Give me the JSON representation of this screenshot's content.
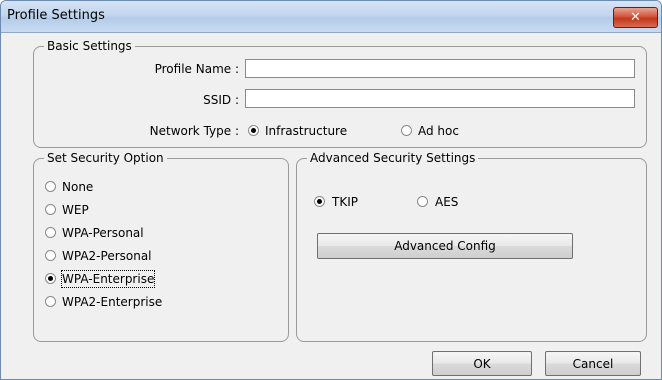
{
  "window": {
    "title": "Profile Settings",
    "close_glyph": "✕"
  },
  "basic": {
    "legend": "Basic Settings",
    "profile_name_label": "Profile Name :",
    "profile_name_value": "",
    "ssid_label": "SSID :",
    "ssid_value": "",
    "network_type_label": "Network Type :",
    "options": [
      "Infrastructure",
      "Ad hoc"
    ],
    "selected": "Infrastructure"
  },
  "security": {
    "legend": "Set Security Option",
    "options": [
      "None",
      "WEP",
      "WPA-Personal",
      "WPA2-Personal",
      "WPA-Enterprise",
      "WPA2-Enterprise"
    ],
    "selected": "WPA-Enterprise"
  },
  "advanced": {
    "legend": "Advanced Security Settings",
    "options": [
      "TKIP",
      "AES"
    ],
    "selected": "TKIP",
    "config_button": "Advanced Config"
  },
  "footer": {
    "ok_label": "OK",
    "cancel_label": "Cancel"
  },
  "colors": {
    "titlebar": "#c2d6ee",
    "close_button": "#c2371c",
    "dialog_bg": "#f0f0f0"
  }
}
